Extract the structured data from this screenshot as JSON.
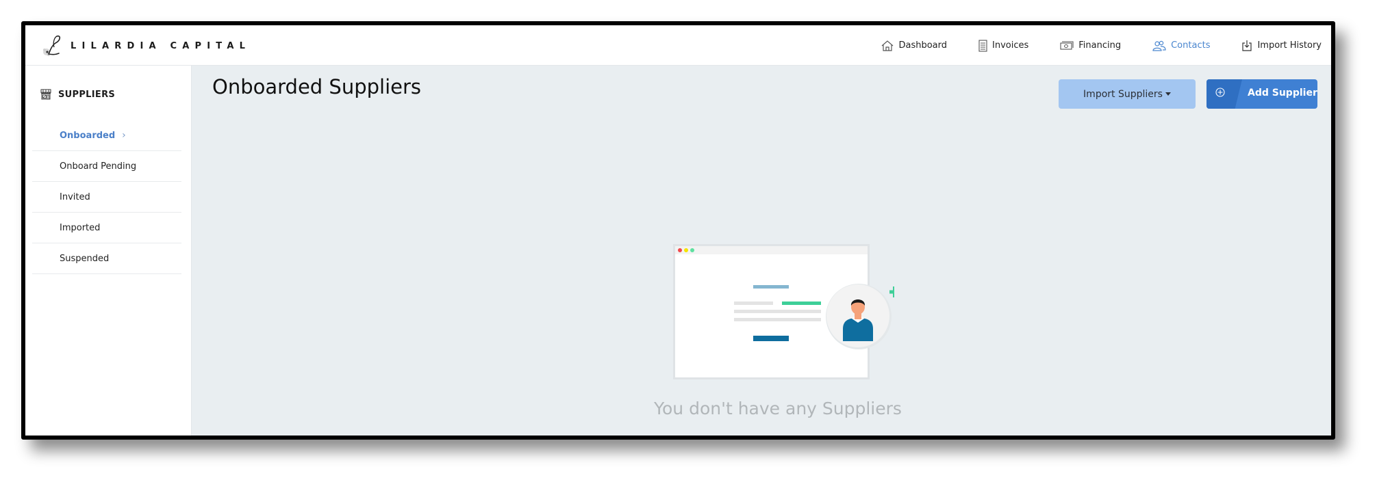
{
  "app": {
    "brand": "LILARDIA CAPITAL",
    "logo_icon": "script-l-monogram-icon"
  },
  "nav": {
    "items": [
      {
        "label": "Dashboard",
        "icon": "home-icon",
        "active": false
      },
      {
        "label": "Invoices",
        "icon": "document-icon",
        "active": false
      },
      {
        "label": "Financing",
        "icon": "money-icon",
        "active": false
      },
      {
        "label": "Contacts",
        "icon": "contacts-icon",
        "active": true
      },
      {
        "label": "Import History",
        "icon": "import-box-icon",
        "active": false
      }
    ],
    "active_color": "#4a86cf"
  },
  "sidebar": {
    "section_title": "SUPPLIERS",
    "section_icon": "storefront-icon",
    "items": [
      {
        "label": "Onboarded",
        "active": true,
        "chevron": "›"
      },
      {
        "label": "Onboard Pending",
        "active": false
      },
      {
        "label": "Invited",
        "active": false
      },
      {
        "label": "Imported",
        "active": false
      },
      {
        "label": "Suspended",
        "active": false
      }
    ]
  },
  "main": {
    "title": "Onboarded Suppliers",
    "buttons": {
      "import_label": "Import Suppliers",
      "add_label": "Add Supplier",
      "add_icon": "circle-plus-icon"
    },
    "empty_state": {
      "message": "You don't have any Suppliers",
      "illustration": "browser-window-with-user-plus-illustration"
    }
  },
  "colors": {
    "primary": "#3f80d3",
    "primary_light": "#a3c6f1",
    "accent_green": "#3ecf98",
    "main_bg": "#e9eef1"
  }
}
